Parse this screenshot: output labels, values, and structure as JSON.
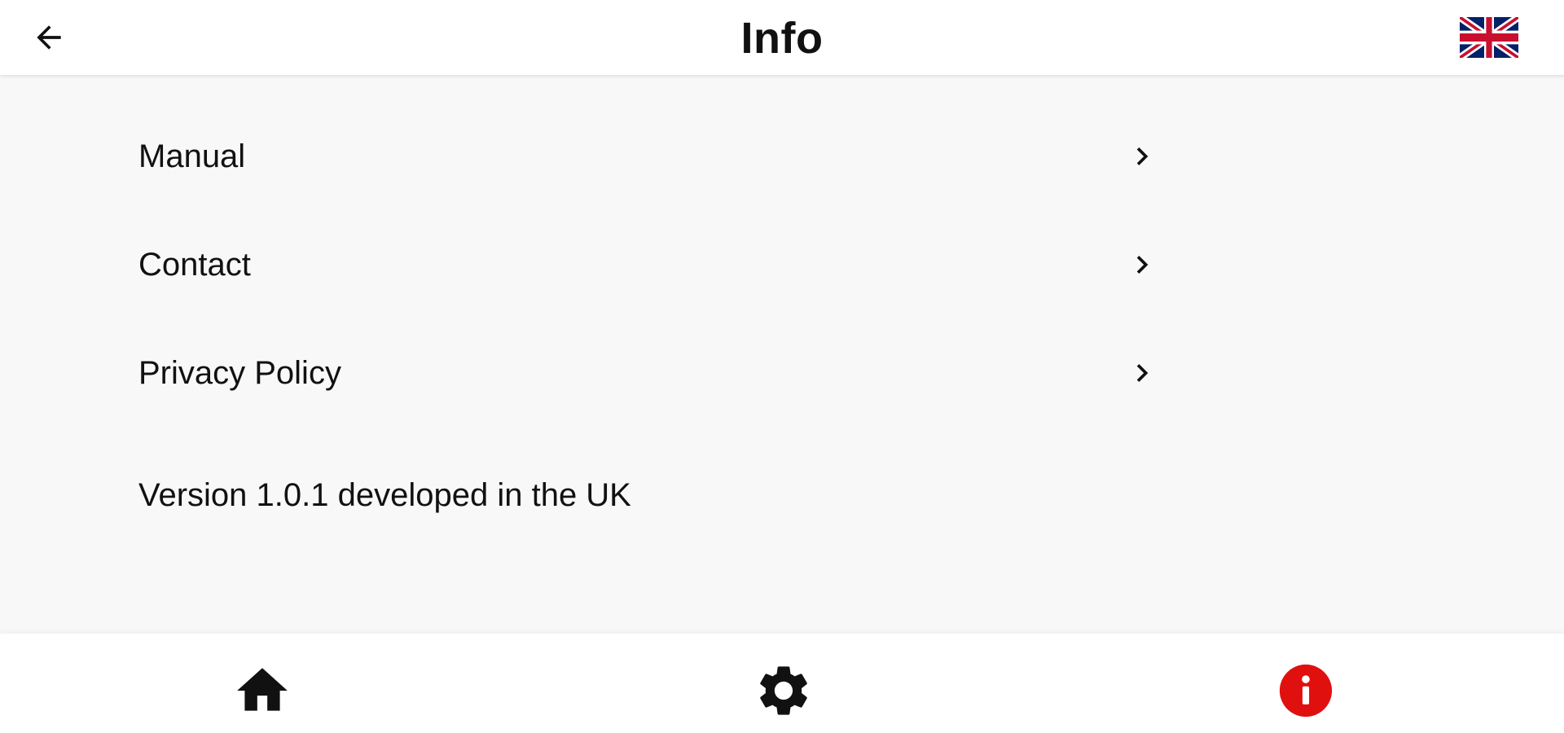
{
  "header": {
    "title": "Info",
    "back_icon": "arrow-left-icon",
    "language_icon": "uk-flag-icon"
  },
  "menu": {
    "items": [
      {
        "label": "Manual",
        "icon": "chevron-right-icon"
      },
      {
        "label": "Contact",
        "icon": "chevron-right-icon"
      },
      {
        "label": "Privacy Policy",
        "icon": "chevron-right-icon"
      }
    ],
    "version_text": "Version 1.0.1 developed in the UK"
  },
  "bottom_nav": {
    "items": [
      {
        "icon": "home-icon",
        "active": false
      },
      {
        "icon": "gear-icon",
        "active": false
      },
      {
        "icon": "info-icon",
        "active": true
      }
    ]
  },
  "colors": {
    "accent": "#e0100f",
    "background": "#f8f8f8",
    "surface": "#ffffff",
    "text": "#111111"
  }
}
